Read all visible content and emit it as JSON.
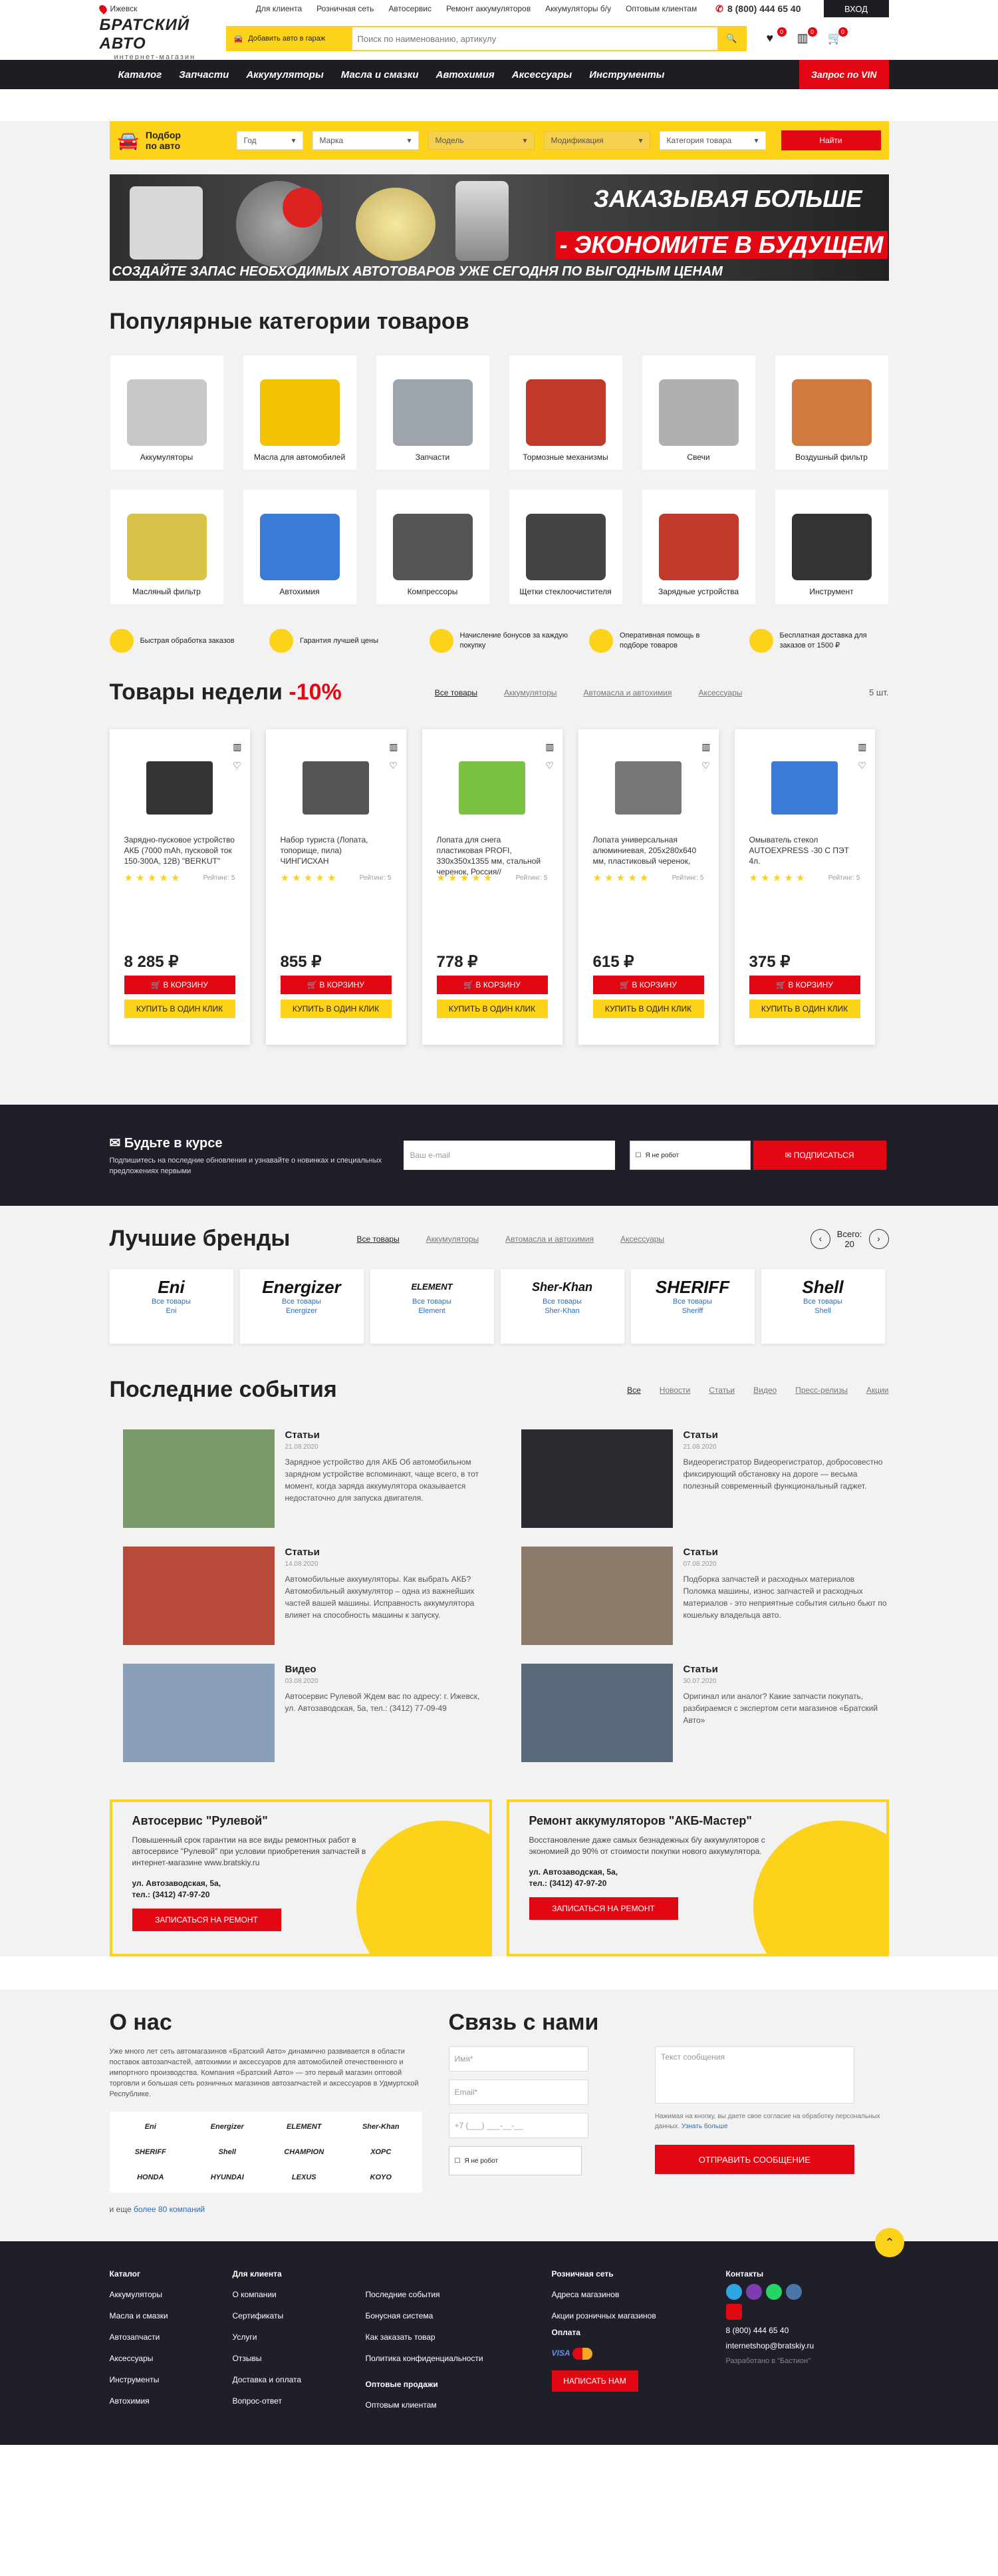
{
  "topbar": {
    "city": "Ижевск",
    "links": [
      "Для клиента",
      "Розничная сеть",
      "Автосервис",
      "Ремонт аккумуляторов",
      "Аккумуляторы б/у",
      "Оптовым клиентам"
    ],
    "phone": "8 (800) 444 65 40",
    "login": "ВХОД"
  },
  "header": {
    "logo_main": "БРАТСКИЙ АВТО",
    "logo_sub": "интернет-магазин",
    "add_car": "Добавить авто в гараж",
    "search_placeholder": "Поиск по наименованию, артикулу",
    "badges": [
      "0",
      "0",
      "0"
    ]
  },
  "nav": [
    "Каталог",
    "Запчасти",
    "Аккумуляторы",
    "Масла и смазки",
    "Автохимия",
    "Аксессуары",
    "Инструменты"
  ],
  "nav_vin": "Запрос по VIN",
  "selector": {
    "title": "Подбор по авто",
    "fields": [
      "Год",
      "Марка",
      "Модель",
      "Модификация",
      "Категория товара"
    ],
    "button": "Найти"
  },
  "banner": {
    "line1": "ЗАКАЗЫВАЯ БОЛЬШЕ",
    "line2": "- ЭКОНОМИТЕ В БУДУЩЕМ",
    "line3": "СОЗДАЙТЕ ЗАПАС НЕОБХОДИМЫХ АВТОТОВАРОВ УЖЕ СЕГОДНЯ ПО ВЫГОДНЫМ ЦЕНАМ"
  },
  "categories_title": "Популярные категории товаров",
  "categories": [
    {
      "label": "Аккумуляторы",
      "color": "#c8c8c8"
    },
    {
      "label": "Масла для автомобилей",
      "color": "#f2c200"
    },
    {
      "label": "Запчасти",
      "color": "#9ea4ab"
    },
    {
      "label": "Тормозные механизмы",
      "color": "#c0392b"
    },
    {
      "label": "Свечи",
      "color": "#b0b0b0"
    },
    {
      "label": "Воздушный фильтр",
      "color": "#d07a40"
    },
    {
      "label": "Масляный фильтр",
      "color": "#d8c24a"
    },
    {
      "label": "Автохимия",
      "color": "#3a7bd5"
    },
    {
      "label": "Компрессоры",
      "color": "#555"
    },
    {
      "label": "Щетки стеклоочистителя",
      "color": "#444"
    },
    {
      "label": "Зарядные устройства",
      "color": "#c0392b"
    },
    {
      "label": "Инструмент",
      "color": "#333"
    }
  ],
  "features": [
    "Быстрая обработка заказов",
    "Гарантия лучшей цены",
    "Начисление бонусов за каждую покупку",
    "Оперативная помощь в подборе товаров",
    "Бесплатная доставка для заказов от 1500 ₽"
  ],
  "week": {
    "title": "Товары недели",
    "discount": "-10%",
    "tabs": [
      "Все товары",
      "Аккумуляторы",
      "Автомасла и автохимия",
      "Аксессуары"
    ],
    "count": "5 шт.",
    "rating_label": "Рейтинг: 5",
    "cart": "В КОРЗИНУ",
    "oneclick": "КУПИТЬ В ОДИН КЛИК",
    "products": [
      {
        "name": "Зарядно-пусковое устройство АКБ (7000 mAh, пусковой ток 150-300А, 12В) \"BERKUT\"",
        "price": "8 285 ₽",
        "color": "#333"
      },
      {
        "name": "Набор туриста (Лопата, топорище, пила) ЧИНГИСХАН",
        "price": "855 ₽",
        "color": "#555"
      },
      {
        "name": "Лопата для снега пластиковая PROFI, 330х350х1355 мм, стальной черенок, Россия//",
        "price": "778 ₽",
        "color": "#7cc242"
      },
      {
        "name": "Лопата универсальная алюминиевая, 205х280х640 мм, пластиковый черенок,",
        "price": "615 ₽",
        "color": "#777"
      },
      {
        "name": "Омыватель стекол AUTOEXPRESS -30 С ПЭТ 4л.",
        "price": "375 ₽",
        "color": "#3a7bd5"
      }
    ]
  },
  "subscribe": {
    "title": "Будьте в курсе",
    "text": "Подпишитесь на последние обновления и узнавайте о новинках и специальных предложениях первыми",
    "email_placeholder": "Ваш e-mail",
    "captcha": "Я не робот",
    "button": "ПОДПИСАТЬСЯ"
  },
  "brands": {
    "title": "Лучшие бренды",
    "tabs": [
      "Все товары",
      "Аккумуляторы",
      "Автомасла и автохимия",
      "Аксессуары"
    ],
    "total_label": "Всего:",
    "total": "20",
    "all_goods": "Все товары",
    "items": [
      {
        "logo": "Eni",
        "name": "Eni"
      },
      {
        "logo": "Energizer",
        "name": "Energizer"
      },
      {
        "logo": "ELEMENT",
        "name": "Element"
      },
      {
        "logo": "Sher-Khan",
        "name": "Sher-Khan"
      },
      {
        "logo": "SHERIFF",
        "name": "Sheriff"
      },
      {
        "logo": "Shell",
        "name": "Shell"
      }
    ]
  },
  "events": {
    "title": "Последние события",
    "tabs": [
      "Все",
      "Новости",
      "Статьи",
      "Видео",
      "Пресс-релизы",
      "Акции"
    ],
    "items": [
      {
        "cat": "Статьи",
        "date": "21.08.2020",
        "text": "Зарядное устройство для АКБ Об автомобильном зарядном устройстве вспоминают, чаще всего, в тот момент, когда заряда аккумулятора оказывается недостаточно для запуска двигателя.",
        "color": "#7a9a6a"
      },
      {
        "cat": "Статьи",
        "date": "21.08.2020",
        "text": "Видеорегистратор Видеорегистратор, добросовестно фиксирующий обстановку на дороге — весьма полезный современный функциональный гаджет.",
        "color": "#2a2a30"
      },
      {
        "cat": "Статьи",
        "date": "14.08.2020",
        "text": "Автомобильные аккумуляторы. Как выбрать АКБ? Автомобильный аккумулятор – одна из важнейших частей вашей машины. Исправность аккумулятора влияет на способность машины к запуску.",
        "color": "#b84a3a"
      },
      {
        "cat": "Статьи",
        "date": "07.08.2020",
        "text": "Подборка запчастей и расходных материалов Поломка машины, износ запчастей и расходных материалов - это неприятные события сильно бьют по кошельку владельца авто.",
        "color": "#8a7a6a"
      },
      {
        "cat": "Видео",
        "date": "03.08.2020",
        "text": "Автосервис Рулевой Ждем вас по адресу: г. Ижевск, ул. Автозаводская, 5а, тел.: (3412) 77-09-49",
        "color": "#8aa0b8"
      },
      {
        "cat": "Статьи",
        "date": "30.07.2020",
        "text": "Оригинал или аналог? Какие запчасти покупать, разбираемся с экспертом сети магазинов «Братский Авто»",
        "color": "#5a6a7a"
      }
    ]
  },
  "services": [
    {
      "title": "Автосервис \"Рулевой\"",
      "text": "Повышенный срок гарантии на все виды ремонтных работ в автосервисе \"Рулевой\" при условии приобретения запчастей в интернет-магазине www.bratskiy.ru",
      "addr": "ул. Автозаводская, 5а,",
      "tel": "тел.: (3412) 47-97-20",
      "button": "ЗАПИСАТЬСЯ НА РЕМОНТ"
    },
    {
      "title": "Ремонт аккумуляторов \"АКБ-Мастер\"",
      "text": "Восстановление даже самых безнадежных б/у аккумуляторов с экономией до 90% от стоимости покупки нового аккумулятора.",
      "addr": "ул. Автозаводская, 5а,",
      "tel": "тел.: (3412) 47-97-20",
      "button": "ЗАПИСАТЬСЯ НА РЕМОНТ"
    }
  ],
  "about": {
    "title": "О нас",
    "text": "Уже много лет сеть автомагазинов «Братский Авто» динамично развивается в области поставок автозапчастей, автохимии и аксессуаров для автомобилей отечественного и импортного производства. Компания «Братский Авто» — это первый магазин оптовой торговли и большая сеть розничных магазинов автозапчастей и аксессуаров в Удмуртской Республике.",
    "logos": [
      "Eni",
      "Energizer",
      "ELEMENT",
      "Sher-Khan",
      "SHERIFF",
      "Shell",
      "CHAMPION",
      "ХОРС",
      "HONDA",
      "HYUNDAI",
      "LEXUS",
      "KOYO"
    ],
    "more_prefix": "и еще",
    "more_link": "более 80 компаний"
  },
  "contact": {
    "title": "Связь с нами",
    "name": "Имя*",
    "email": "Email*",
    "phone": "+7 (___) ___-__-__",
    "message": "Текст сообщения",
    "agree": "Нажимая на кнопку, вы даете свое согласие на обработку персональных данных.",
    "agree_link": "Узнать больше",
    "captcha": "Я не робот",
    "button": "ОТПРАВИТЬ СООБЩЕНИЕ"
  },
  "footer": {
    "cols": [
      {
        "title": "Каталог",
        "items": [
          "Аккумуляторы",
          "Масла и смазки",
          "Автозапчасти",
          "Аксессуары",
          "Инструменты",
          "Автохимия"
        ]
      },
      {
        "title": "Для клиента",
        "items": [
          "О компании",
          "Сертификаты",
          "Услуги",
          "Отзывы",
          "Доставка и оплата",
          "Вопрос-ответ"
        ]
      },
      {
        "title": "",
        "items": [
          "Последние события",
          "Бонусная система",
          "Как заказать товар",
          "Политика конфиденциальности"
        ]
      },
      {
        "title": "Розничная сеть",
        "items": [
          "Адреса магазинов",
          "Акции розничных магазинов"
        ]
      }
    ],
    "wholesale_title": "Оптовые продажи",
    "wholesale_item": "Оптовым клиентам",
    "payment_title": "Оплата",
    "write_btn": "НАПИСАТЬ НАМ",
    "contacts_title": "Контакты",
    "phone": "8 (800) 444 65 40",
    "email": "internetshop@bratskiy.ru",
    "dev": "Разработано в \"Бастион\""
  }
}
